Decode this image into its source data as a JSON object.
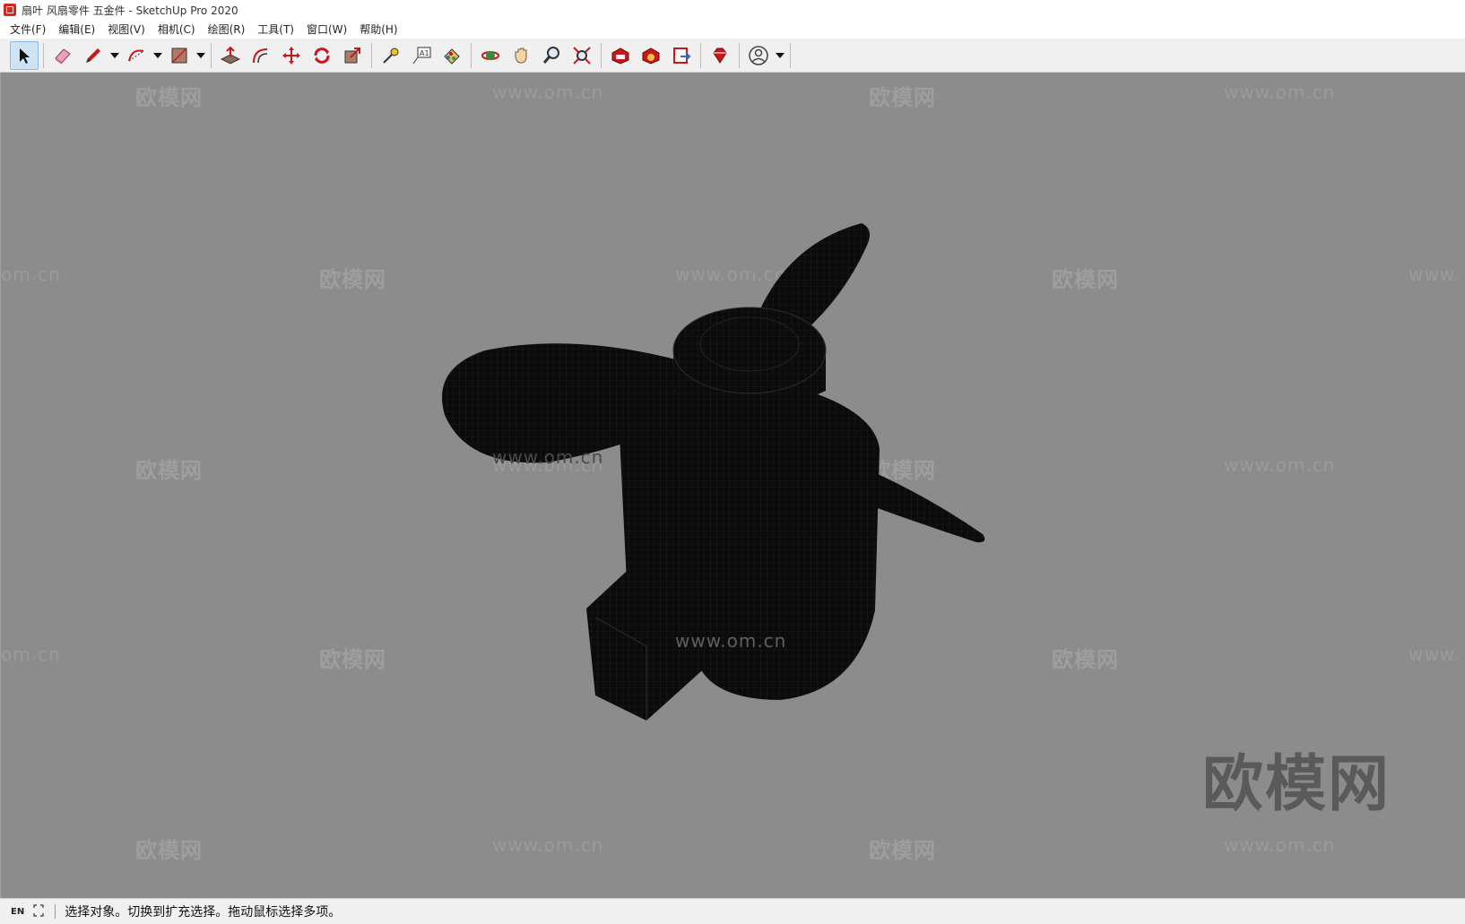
{
  "window": {
    "title": "扇叶 风扇零件 五金件 - SketchUp Pro 2020",
    "icon": "sketchup-logo-icon"
  },
  "menu": [
    {
      "label": "文件(F)"
    },
    {
      "label": "编辑(E)"
    },
    {
      "label": "视图(V)"
    },
    {
      "label": "相机(C)"
    },
    {
      "label": "绘图(R)"
    },
    {
      "label": "工具(T)"
    },
    {
      "label": "窗口(W)"
    },
    {
      "label": "帮助(H)"
    }
  ],
  "toolbar": {
    "tools": [
      "select-icon",
      "eraser-icon",
      "pencil-icon",
      "arc-icon",
      "rectangle-icon",
      "push-pull-icon",
      "offset-icon",
      "move-icon",
      "rotate-icon",
      "scale-icon",
      "tape-measure-icon",
      "text-icon",
      "paint-bucket-icon",
      "orbit-icon",
      "pan-icon",
      "zoom-icon",
      "zoom-extents-icon",
      "warehouse-icon",
      "extension-warehouse-icon",
      "layout-icon",
      "ruby-icon",
      "account-icon"
    ],
    "active_tool": "select-icon",
    "text_tool_glyph": "A1"
  },
  "viewport": {
    "background": "#8c8c8c",
    "watermark_brand": "欧模网",
    "watermark_url": "www.om.cn",
    "watermark_url_partial_left": "om.cn",
    "watermark_url_partial_right": "www.",
    "corner_logo": "欧模网"
  },
  "statusbar": {
    "lang": "EN",
    "message": "选择对象。切换到扩充选择。拖动鼠标选择多项。"
  }
}
